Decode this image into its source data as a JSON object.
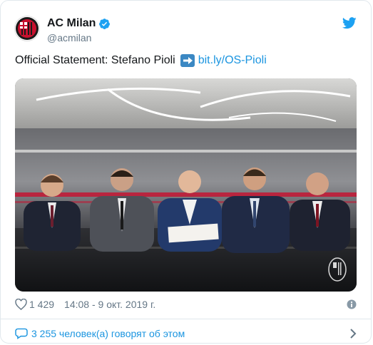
{
  "tweet": {
    "name": "AC Milan",
    "handle": "@acmilan",
    "text_before": "Official Statement: Stefano Pioli",
    "link": "bit.ly/OS-Pioli",
    "likes": "1 429",
    "timestamp": "14:08 - 9 окт. 2019 г.",
    "people_talking": "3 255 человек(а) говорят об этом"
  },
  "colors": {
    "accent": "#1b95e0",
    "verified": "#1da1f2",
    "milan_red": "#c8102e"
  },
  "icons": {
    "avatar": "ac-milan-crest",
    "verified": "verified-badge-icon",
    "brand": "twitter-bird-icon",
    "emoji": "right-arrow-emoji",
    "like": "heart-icon",
    "info": "info-icon",
    "replies": "speech-bubble-icon",
    "more": "chevron-right-icon"
  }
}
